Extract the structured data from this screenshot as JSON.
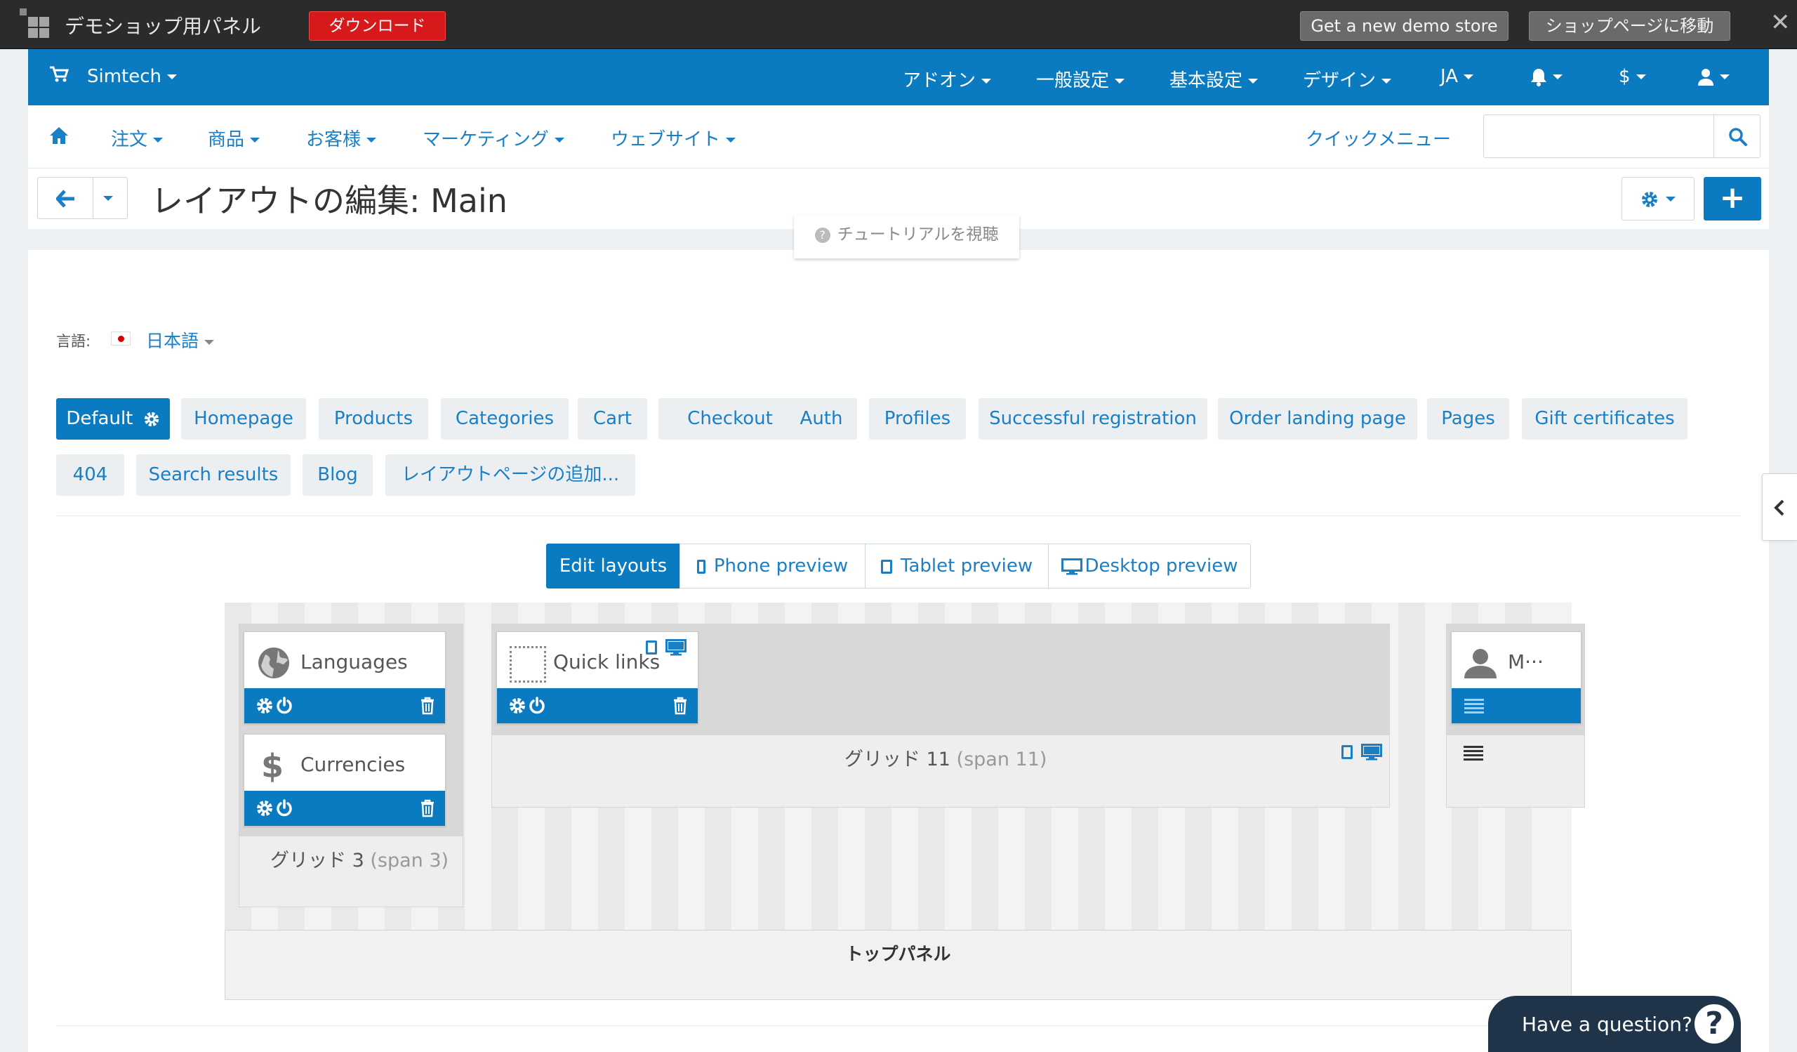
{
  "demo_bar": {
    "title": "デモショップ用パネル",
    "download_label": "ダウンロード",
    "new_store_label": "Get a new demo store",
    "goto_shop_label": "ショップページに移動",
    "close_label": "✕"
  },
  "top_nav": {
    "store_name": "Simtech",
    "items": [
      "アドオン",
      "一般設定",
      "基本設定",
      "デザイン",
      "JA"
    ],
    "currency_label": "$"
  },
  "sub_nav": {
    "items": [
      "注文",
      "商品",
      "お客様",
      "マーケティング",
      "ウェブサイト"
    ],
    "quick_menu": "クイックメニュー",
    "search_placeholder": ""
  },
  "title_bar": {
    "title": "レイアウトの編集: Main",
    "tutorial": "チュートリアルを視聴",
    "plus_label": "+"
  },
  "language": {
    "label": "言語:",
    "value": "日本語"
  },
  "layout_tabs": {
    "row1": [
      "Default",
      "Homepage",
      "Products",
      "Categories",
      "Cart",
      "Checkout",
      "Auth",
      "Profiles",
      "Successful registration",
      "Order landing page",
      "Pages",
      "Gift certificates"
    ],
    "row2": [
      "404",
      "Search results",
      "Blog",
      "レイアウトページの追加..."
    ]
  },
  "view_modes": [
    "Edit layouts",
    "Phone preview",
    "Tablet preview",
    "Desktop preview"
  ],
  "editor": {
    "grids": [
      {
        "label": "グリッド 3",
        "span": "(span 3)",
        "blocks": [
          "Languages",
          "Currencies"
        ]
      },
      {
        "label": "グリッド 11",
        "span": "(span 11)",
        "blocks": [
          "Quick links"
        ]
      },
      {
        "label": "",
        "span": "",
        "blocks": [
          "M···"
        ]
      }
    ],
    "container_label": "トップパネル"
  },
  "help": {
    "label": "Have a question?",
    "icon_label": "?"
  },
  "colors": {
    "primary": "#0b7bc1",
    "link": "#1a7fc4",
    "download": "#d6191b",
    "help_bg": "#1f3448"
  }
}
